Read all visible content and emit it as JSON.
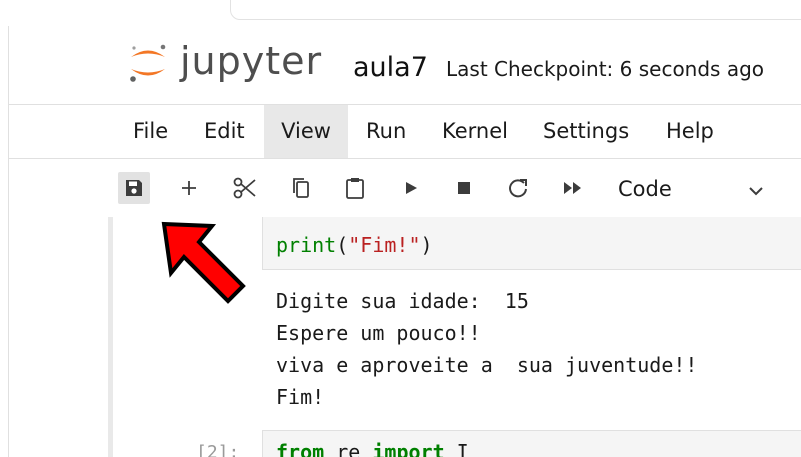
{
  "header": {
    "brand": "jupyter",
    "notebook_name": "aula7",
    "checkpoint": "Last Checkpoint: 6 seconds ago"
  },
  "menu": {
    "items": [
      {
        "label": "File"
      },
      {
        "label": "Edit"
      },
      {
        "label": "View",
        "active": true
      },
      {
        "label": "Run"
      },
      {
        "label": "Kernel"
      },
      {
        "label": "Settings"
      },
      {
        "label": "Help"
      }
    ]
  },
  "toolbar": {
    "buttons": [
      "save-icon",
      "add-cell-icon",
      "cut-icon",
      "copy-icon",
      "paste-icon",
      "run-icon",
      "stop-icon",
      "restart-icon",
      "fast-forward-icon"
    ],
    "cell_type": "Code"
  },
  "cell1": {
    "code_print": "print",
    "code_arg": "\"Fim!\"",
    "output_lines": [
      "Digite sua idade:  15",
      "Espere um pouco!!",
      "viva e aproveite a  sua juventude!!",
      "Fim!"
    ]
  },
  "cell2": {
    "prompt": "[2]:",
    "kw_from": "from",
    "module": "re",
    "kw_import": "import",
    "name": "I"
  },
  "colors": {
    "accent_orange": "#f37726",
    "arrow_red": "#ff0000",
    "code_green": "#008000",
    "string_red": "#ba2121"
  }
}
